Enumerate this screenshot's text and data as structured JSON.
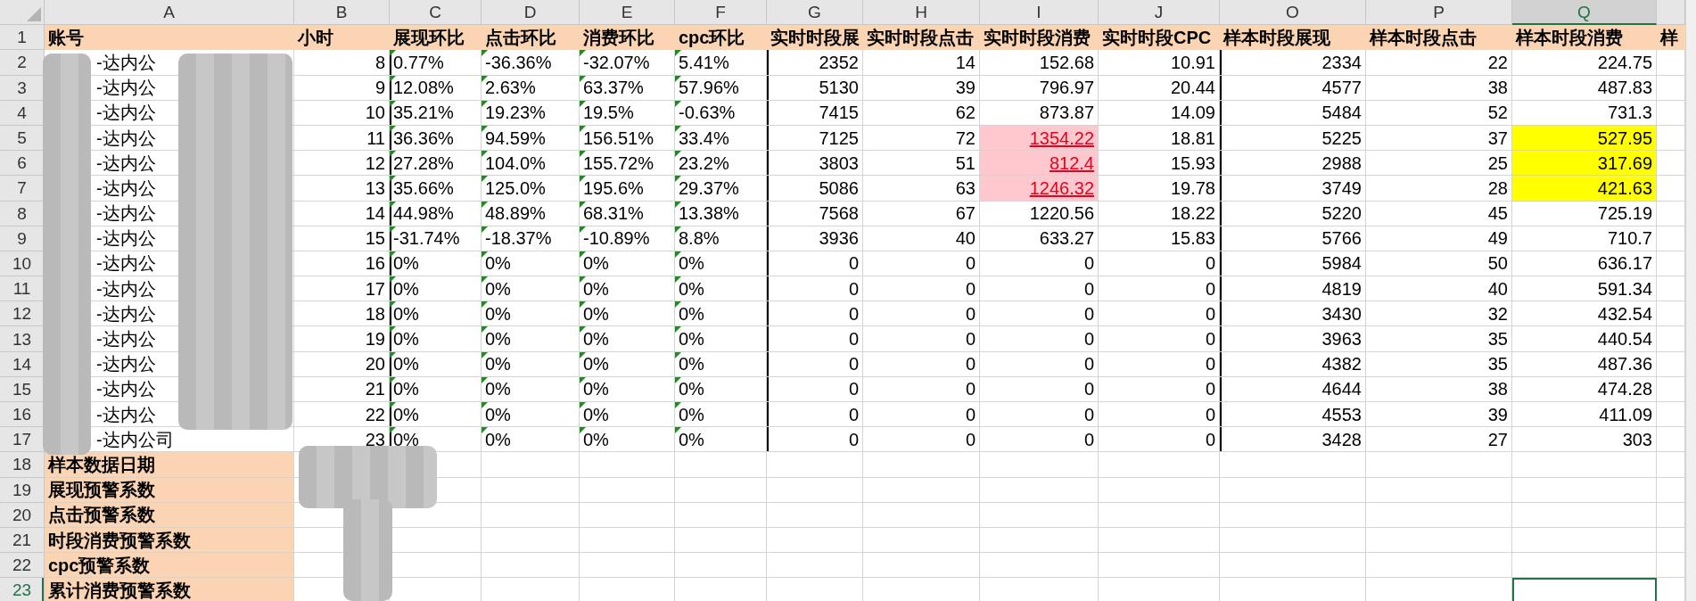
{
  "columns": [
    {
      "letter": "A",
      "kind": "label",
      "selected": false,
      "group_start": false
    },
    {
      "letter": "B",
      "kind": "number",
      "selected": false,
      "group_start": false
    },
    {
      "letter": "C",
      "kind": "text",
      "selected": false,
      "group_start": true
    },
    {
      "letter": "D",
      "kind": "text",
      "selected": false,
      "group_start": false
    },
    {
      "letter": "E",
      "kind": "text",
      "selected": false,
      "group_start": false
    },
    {
      "letter": "F",
      "kind": "text",
      "selected": false,
      "group_start": false
    },
    {
      "letter": "G",
      "kind": "number",
      "selected": false,
      "group_start": true
    },
    {
      "letter": "H",
      "kind": "number",
      "selected": false,
      "group_start": false
    },
    {
      "letter": "I",
      "kind": "warning",
      "selected": false,
      "group_start": false
    },
    {
      "letter": "J",
      "kind": "number",
      "selected": false,
      "group_start": false
    },
    {
      "letter": "O",
      "kind": "number",
      "selected": false,
      "group_start": true
    },
    {
      "letter": "P",
      "kind": "number",
      "selected": false,
      "group_start": false
    },
    {
      "letter": "Q",
      "kind": "marker",
      "selected": true,
      "group_start": false
    }
  ],
  "header_row": {
    "number": "1",
    "cells": [
      "账号",
      "小时",
      "展现环比",
      "点击环比",
      "消费环比",
      "cpc环比",
      "实时时段展",
      "实时时段点击",
      "实时时段消费",
      "实时时段CPC",
      "样本时段展现",
      "样本时段点击",
      "样本时段消费",
      "样"
    ]
  },
  "rows": [
    {
      "number": "2",
      "kind": "data",
      "selected": false,
      "alert": false,
      "cells": [
        "-达内公",
        "8",
        "0.77%",
        "-36.36%",
        "-32.07%",
        "5.41%",
        "2352",
        "14",
        "152.68",
        "10.91",
        "2334",
        "22",
        "224.75"
      ]
    },
    {
      "number": "3",
      "kind": "data",
      "selected": false,
      "alert": false,
      "cells": [
        "-达内公",
        "9",
        "12.08%",
        "2.63%",
        "63.37%",
        "57.96%",
        "5130",
        "39",
        "796.97",
        "20.44",
        "4577",
        "38",
        "487.83"
      ]
    },
    {
      "number": "4",
      "kind": "data",
      "selected": false,
      "alert": false,
      "cells": [
        "-达内公",
        "10",
        "35.21%",
        "19.23%",
        "19.5%",
        "-0.63%",
        "7415",
        "62",
        "873.87",
        "14.09",
        "5484",
        "52",
        "731.3"
      ]
    },
    {
      "number": "5",
      "kind": "data",
      "selected": false,
      "alert": true,
      "cells": [
        "-达内公",
        "11",
        "36.36%",
        "94.59%",
        "156.51%",
        "33.4%",
        "7125",
        "72",
        "1354.22",
        "18.81",
        "5225",
        "37",
        "527.95"
      ]
    },
    {
      "number": "6",
      "kind": "data",
      "selected": false,
      "alert": true,
      "cells": [
        "-达内公",
        "12",
        "27.28%",
        "104.0%",
        "155.72%",
        "23.2%",
        "3803",
        "51",
        "812.4",
        "15.93",
        "2988",
        "25",
        "317.69"
      ]
    },
    {
      "number": "7",
      "kind": "data",
      "selected": false,
      "alert": true,
      "cells": [
        "-达内公",
        "13",
        "35.66%",
        "125.0%",
        "195.6%",
        "29.37%",
        "5086",
        "63",
        "1246.32",
        "19.78",
        "3749",
        "28",
        "421.63"
      ]
    },
    {
      "number": "8",
      "kind": "data",
      "selected": false,
      "alert": false,
      "cells": [
        "-达内公",
        "14",
        "44.98%",
        "48.89%",
        "68.31%",
        "13.38%",
        "7568",
        "67",
        "1220.56",
        "18.22",
        "5220",
        "45",
        "725.19"
      ]
    },
    {
      "number": "9",
      "kind": "data",
      "selected": false,
      "alert": false,
      "cells": [
        "-达内公",
        "15",
        "-31.74%",
        "-18.37%",
        "-10.89%",
        "8.8%",
        "3936",
        "40",
        "633.27",
        "15.83",
        "5766",
        "49",
        "710.7"
      ]
    },
    {
      "number": "10",
      "kind": "data",
      "selected": false,
      "alert": false,
      "cells": [
        "-达内公",
        "16",
        "0%",
        "0%",
        "0%",
        "0%",
        "0",
        "0",
        "0",
        "0",
        "5984",
        "50",
        "636.17"
      ]
    },
    {
      "number": "11",
      "kind": "data",
      "selected": false,
      "alert": false,
      "cells": [
        "-达内公",
        "17",
        "0%",
        "0%",
        "0%",
        "0%",
        "0",
        "0",
        "0",
        "0",
        "4819",
        "40",
        "591.34"
      ]
    },
    {
      "number": "12",
      "kind": "data",
      "selected": false,
      "alert": false,
      "cells": [
        "-达内公",
        "18",
        "0%",
        "0%",
        "0%",
        "0%",
        "0",
        "0",
        "0",
        "0",
        "3430",
        "32",
        "432.54"
      ]
    },
    {
      "number": "13",
      "kind": "data",
      "selected": false,
      "alert": false,
      "cells": [
        "-达内公",
        "19",
        "0%",
        "0%",
        "0%",
        "0%",
        "0",
        "0",
        "0",
        "0",
        "3963",
        "35",
        "440.54"
      ]
    },
    {
      "number": "14",
      "kind": "data",
      "selected": false,
      "alert": false,
      "cells": [
        "-达内公",
        "20",
        "0%",
        "0%",
        "0%",
        "0%",
        "0",
        "0",
        "0",
        "0",
        "4382",
        "35",
        "487.36"
      ]
    },
    {
      "number": "15",
      "kind": "data",
      "selected": false,
      "alert": false,
      "cells": [
        "-达内公",
        "21",
        "0%",
        "0%",
        "0%",
        "0%",
        "0",
        "0",
        "0",
        "0",
        "4644",
        "38",
        "474.28"
      ]
    },
    {
      "number": "16",
      "kind": "data",
      "selected": false,
      "alert": false,
      "cells": [
        "-达内公",
        "22",
        "0%",
        "0%",
        "0%",
        "0%",
        "0",
        "0",
        "0",
        "0",
        "4553",
        "39",
        "411.09"
      ]
    },
    {
      "number": "17",
      "kind": "data",
      "selected": false,
      "alert": false,
      "cells": [
        "-达内公司",
        "23",
        "0%",
        "0%",
        "0%",
        "0%",
        "0",
        "0",
        "0",
        "0",
        "3428",
        "27",
        "303"
      ]
    },
    {
      "number": "18",
      "kind": "setting",
      "selected": false,
      "alert": false,
      "cells": [
        "样本数据日期"
      ]
    },
    {
      "number": "19",
      "kind": "setting",
      "selected": false,
      "alert": false,
      "cells": [
        "展现预警系数"
      ]
    },
    {
      "number": "20",
      "kind": "setting",
      "selected": false,
      "alert": false,
      "cells": [
        "点击预警系数"
      ]
    },
    {
      "number": "21",
      "kind": "setting",
      "selected": false,
      "alert": false,
      "cells": [
        "时段消费预警系数"
      ]
    },
    {
      "number": "22",
      "kind": "setting",
      "selected": false,
      "alert": false,
      "cells": [
        "cpc预警系数"
      ]
    },
    {
      "number": "23",
      "kind": "setting",
      "selected": true,
      "alert": false,
      "cells": [
        "累计消费预警系数"
      ]
    }
  ]
}
